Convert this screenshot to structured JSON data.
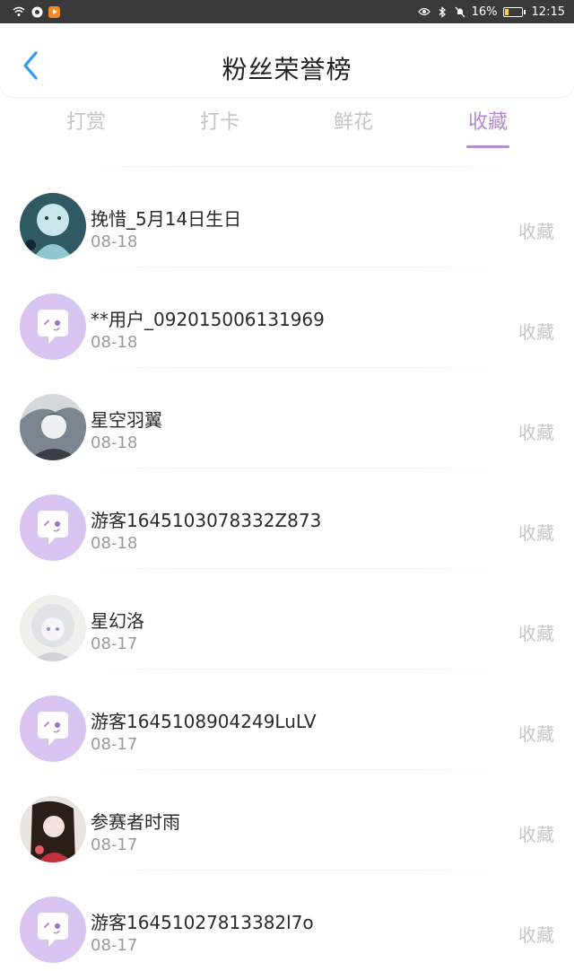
{
  "status_bar": {
    "battery": "16%",
    "time": "12:15"
  },
  "header": {
    "title": "粉丝荣誉榜"
  },
  "tabs": [
    {
      "label": "打赏",
      "active": false
    },
    {
      "label": "打卡",
      "active": false
    },
    {
      "label": "鲜花",
      "active": false
    },
    {
      "label": "收藏",
      "active": true
    }
  ],
  "colors": {
    "accent": "#b58bd3",
    "back_arrow": "#2b9cf0",
    "default_avatar_bg": "#d7c4f0"
  },
  "list": [
    {
      "name": "挽惜_5月14日生日",
      "date": "08-18",
      "action": "收藏",
      "avatar": "photo-dark-teal"
    },
    {
      "name": "**用户_092015006131969",
      "date": "08-18",
      "action": "收藏",
      "avatar": "default-chat-bubble"
    },
    {
      "name": "星空羽翼",
      "date": "08-18",
      "action": "收藏",
      "avatar": "photo-grey"
    },
    {
      "name": "游客1645103078332Z873",
      "date": "08-18",
      "action": "收藏",
      "avatar": "default-chat-bubble"
    },
    {
      "name": "星幻洛",
      "date": "08-17",
      "action": "收藏",
      "avatar": "photo-pale"
    },
    {
      "name": "游客1645108904249LuLV",
      "date": "08-17",
      "action": "收藏",
      "avatar": "default-chat-bubble"
    },
    {
      "name": "参赛者时雨",
      "date": "08-17",
      "action": "收藏",
      "avatar": "photo-red"
    },
    {
      "name": "游客1645102781338​2l7o",
      "date": "08-17",
      "action": "收藏",
      "avatar": "default-chat-bubble"
    }
  ]
}
